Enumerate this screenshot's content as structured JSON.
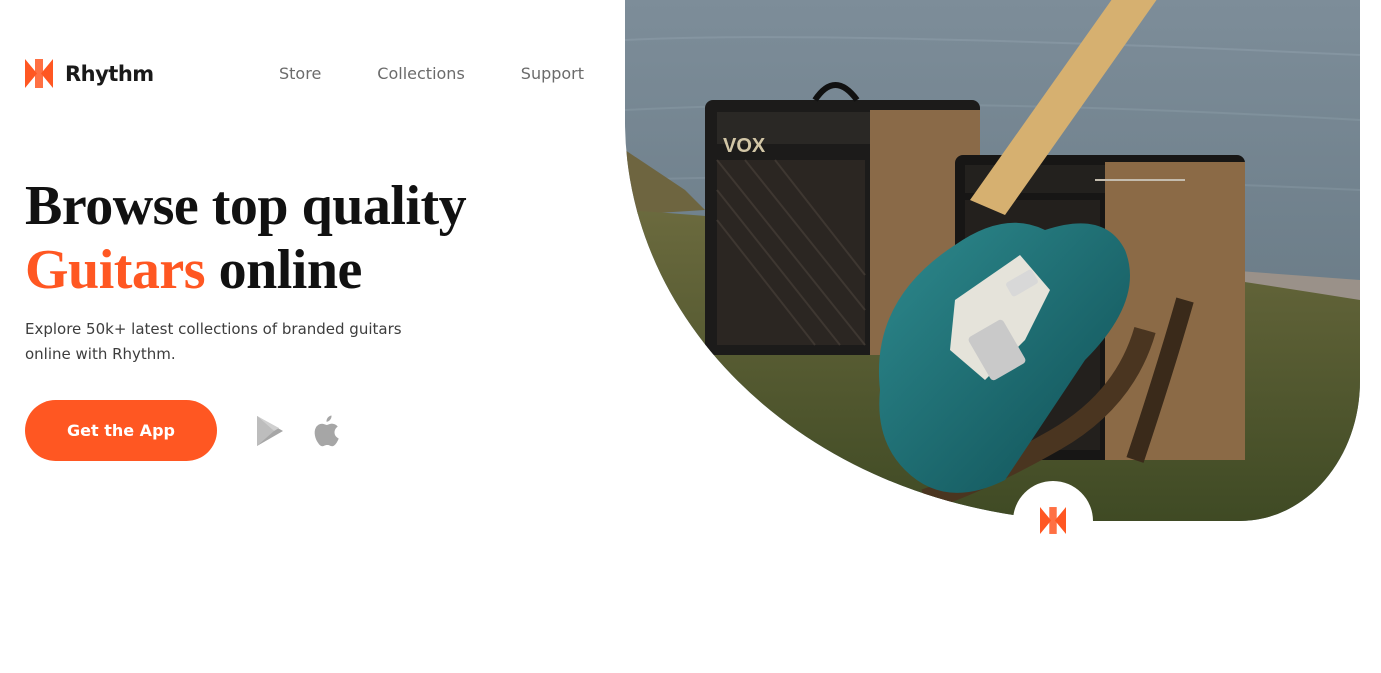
{
  "brand": {
    "name": "Rhythm",
    "accent_color": "#ff5722"
  },
  "nav": {
    "items": [
      {
        "label": "Store"
      },
      {
        "label": "Collections"
      },
      {
        "label": "Support"
      }
    ]
  },
  "hero": {
    "headline_line1": "Browse top quality",
    "headline_accent": "Guitars",
    "headline_line2_rest": " online",
    "subtitle": "Explore 50k+ latest collections of branded guitars online with Rhythm.",
    "cta_label": "Get the App",
    "store_icons": [
      "google-play-icon",
      "apple-icon"
    ],
    "image_subject": "teal electric guitar leaning against two vintage amplifiers on grass by the sea"
  }
}
